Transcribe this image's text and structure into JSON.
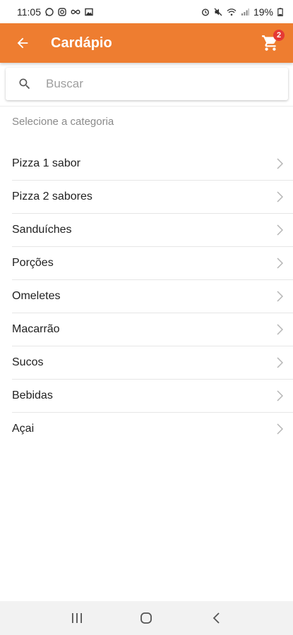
{
  "status_bar": {
    "time": "11:05",
    "left_icons": [
      "whatsapp-icon",
      "instagram-icon",
      "infinity-icon",
      "gallery-icon"
    ],
    "right_icons": [
      "alarm-icon",
      "mute-icon",
      "wifi-icon",
      "signal-icon",
      "battery-icon"
    ],
    "battery": "19%"
  },
  "app_bar": {
    "title": "Cardápio",
    "cart_count": "2",
    "accent_color": "#EE7D30",
    "badge_color": "#E53935"
  },
  "search": {
    "placeholder": "Buscar",
    "value": ""
  },
  "section_label": "Selecione a categoria",
  "categories": [
    {
      "label": "Pizza 1 sabor"
    },
    {
      "label": "Pizza 2 sabores"
    },
    {
      "label": "Sanduíches"
    },
    {
      "label": "Porções"
    },
    {
      "label": "Omeletes"
    },
    {
      "label": "Macarrão"
    },
    {
      "label": "Sucos"
    },
    {
      "label": "Bebidas"
    },
    {
      "label": "Açai"
    }
  ],
  "nav_bar": {
    "buttons": [
      "recents-icon",
      "home-icon",
      "back-icon"
    ]
  }
}
